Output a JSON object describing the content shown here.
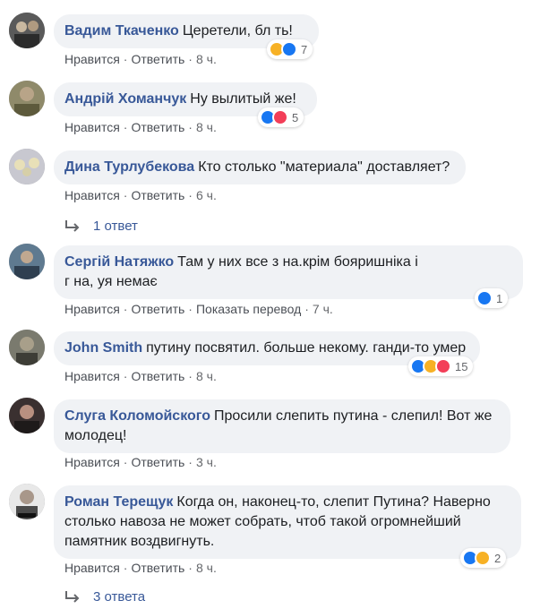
{
  "comments": [
    {
      "author": "Вадим Ткаченко",
      "text": "Церетели, бл ть!",
      "actions": {
        "like": "Нравится",
        "reply": "Ответить",
        "time": "8 ч."
      },
      "reactions": {
        "icons": [
          "haha-icon",
          "like-icon"
        ],
        "count": "7"
      }
    },
    {
      "author": "Андрій Хоманчук",
      "text": "Ну вылитый же!",
      "actions": {
        "like": "Нравится",
        "reply": "Ответить",
        "time": "8 ч."
      },
      "reactions": {
        "icons": [
          "like-icon",
          "love-icon"
        ],
        "count": "5"
      }
    },
    {
      "author": "Дина Турлубекова",
      "text": "Кто столько \"материала\" доставляет?",
      "actions": {
        "like": "Нравится",
        "reply": "Ответить",
        "time": "6 ч."
      },
      "replies": "1 ответ"
    },
    {
      "author": "Сергій Натяжко",
      "text_line1": "Там у них все з    на.крім бояришніка і",
      "text_line2": "г    на,    уя немає",
      "actions": {
        "like": "Нравится",
        "reply": "Ответить",
        "translate": "Показать перевод",
        "time": "7 ч."
      },
      "reactions": {
        "icons": [
          "like-icon"
        ],
        "count": "1"
      }
    },
    {
      "author": "John Smith",
      "text": "путину посвятил. больше некому. ганди-то умер",
      "actions": {
        "like": "Нравится",
        "reply": "Ответить",
        "time": "8 ч."
      },
      "reactions": {
        "icons": [
          "like-icon",
          "haha-icon",
          "love-icon"
        ],
        "count": "15"
      }
    },
    {
      "author": "Слуга Коломойского",
      "text_line1": "Просили слепить путина - слепил! Вот же",
      "text_line2": "молодец!",
      "actions": {
        "like": "Нравится",
        "reply": "Ответить",
        "time": "3 ч."
      }
    },
    {
      "author": "Роман Терещук",
      "text_line1": "Когда он, наконец-то, слепит Путина? Наверно",
      "text_line2": "столько навоза не может собрать, чтоб такой огромнейший",
      "text_line3": "памятник воздвигнуть.",
      "actions": {
        "like": "Нравится",
        "reply": "Ответить",
        "time": "8 ч."
      },
      "reactions": {
        "icons": [
          "like-icon",
          "haha-icon"
        ],
        "count": "2"
      },
      "replies": "3 ответа"
    }
  ],
  "separator": "·",
  "colors": {
    "author": "#385898",
    "bubble": "#f0f2f5",
    "like": "#1877f2",
    "love": "#f33e58",
    "haha": "#f7b125"
  }
}
